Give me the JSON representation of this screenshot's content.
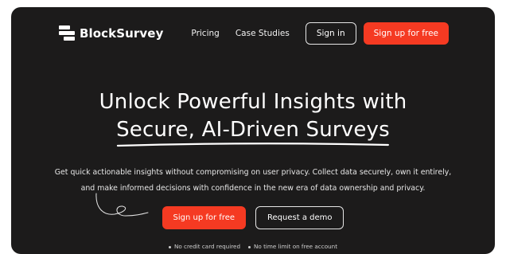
{
  "header": {
    "logo_text": "BlockSurvey",
    "nav": [
      "Pricing",
      "Case Studies"
    ],
    "signin_label": "Sign in",
    "signup_label": "Sign up for free"
  },
  "hero": {
    "headline_line1": "Unlock Powerful Insights with",
    "headline_line2": "Secure, AI-Driven Surveys",
    "subtext_line1": "Get quick actionable insights without compromising on user privacy. Collect data securely, own it entirely,",
    "subtext_line2": "and make informed decisions with confidence in the new era of data ownership and privacy.",
    "cta_primary": "Sign up for free",
    "cta_secondary": "Request a demo",
    "fine_print": [
      "No credit card required",
      "No time limit on free account"
    ]
  },
  "colors": {
    "accent": "#f53a22",
    "background": "#1c1b1b"
  }
}
